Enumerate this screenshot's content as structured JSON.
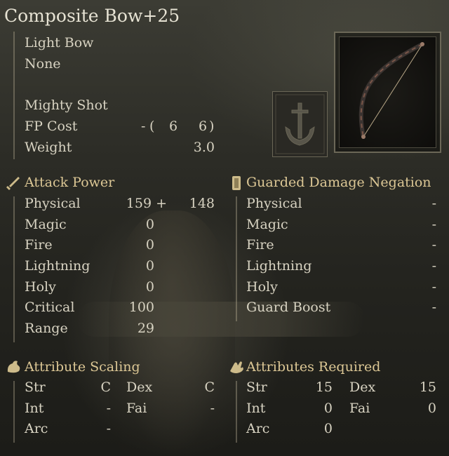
{
  "weapon": {
    "name": "Composite Bow+25",
    "type": "Light Bow",
    "affinity": "None"
  },
  "skill": {
    "name": "Mighty Shot",
    "fp_label": "FP Cost",
    "fp_dash": "-",
    "fp_open": "(",
    "fp_cost_1": "6",
    "fp_cost_2": "6",
    "fp_close": ")",
    "weight_label": "Weight",
    "weight": "3.0"
  },
  "attack_power": {
    "header": "Attack Power",
    "rows": [
      {
        "label": "Physical",
        "value": "159 +",
        "extra": "148"
      },
      {
        "label": "Magic",
        "value": "0"
      },
      {
        "label": "Fire",
        "value": "0"
      },
      {
        "label": "Lightning",
        "value": "0"
      },
      {
        "label": "Holy",
        "value": "0"
      },
      {
        "label": "Critical",
        "value": "100"
      },
      {
        "label": "Range",
        "value": "29"
      }
    ]
  },
  "guard": {
    "header": "Guarded Damage Negation",
    "rows": [
      {
        "label": "Physical",
        "value": "-"
      },
      {
        "label": "Magic",
        "value": "-"
      },
      {
        "label": "Fire",
        "value": "-"
      },
      {
        "label": "Lightning",
        "value": "-"
      },
      {
        "label": "Holy",
        "value": "-"
      },
      {
        "label": "Guard Boost",
        "value": "-"
      }
    ]
  },
  "scaling": {
    "header": "Attribute Scaling",
    "str_label": "Str",
    "str": "C",
    "dex_label": "Dex",
    "dex": "C",
    "int_label": "Int",
    "int": "-",
    "fai_label": "Fai",
    "fai": "-",
    "arc_label": "Arc",
    "arc": "-"
  },
  "required": {
    "header": "Attributes Required",
    "str_label": "Str",
    "str": "15",
    "dex_label": "Dex",
    "dex": "15",
    "int_label": "Int",
    "int": "0",
    "fai_label": "Fai",
    "fai": "0",
    "arc_label": "Arc",
    "arc": "0"
  },
  "icons": {
    "attack": "sword-icon",
    "guard": "shield-icon",
    "scaling": "arm-icon",
    "required": "hand-icon",
    "skill": "ash-of-war-icon",
    "item": "composite-bow-icon"
  },
  "colors": {
    "header": "#dcc795",
    "text": "#d8d3c2",
    "title": "#e6e2d3"
  }
}
